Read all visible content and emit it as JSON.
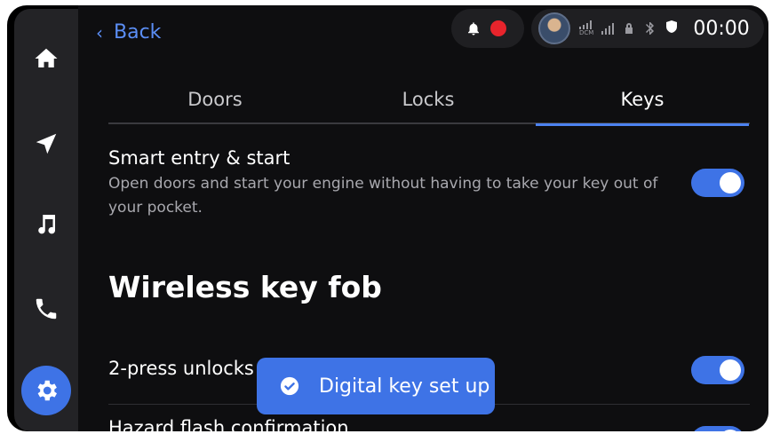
{
  "nav": {
    "home_icon": "home-icon",
    "navigation_icon": "navigation-arrow-icon",
    "music_icon": "music-note-icon",
    "phone_icon": "phone-icon",
    "settings_icon": "gear-icon"
  },
  "header": {
    "back_label": "Back",
    "clock": "00:00",
    "signal_label": "DCM"
  },
  "tabs": [
    {
      "label": "Doors",
      "active": false
    },
    {
      "label": "Locks",
      "active": false
    },
    {
      "label": "Keys",
      "active": true
    }
  ],
  "settings": {
    "smart_entry": {
      "title": "Smart entry & start",
      "description": "Open doors and start your engine without having to take your key out of your pocket.",
      "enabled": true
    },
    "section_title": "Wireless key fob",
    "two_press": {
      "title": "2-press unlocks",
      "enabled": true
    },
    "hazard_flash": {
      "title": "Hazard flash confirmation",
      "enabled": true
    }
  },
  "toast": {
    "message": "Digital key set up",
    "icon": "check-circle-icon"
  },
  "colors": {
    "accent": "#3e73e6",
    "background": "#0e0e10",
    "sidebar": "#232326",
    "link": "#5b8ef5"
  }
}
